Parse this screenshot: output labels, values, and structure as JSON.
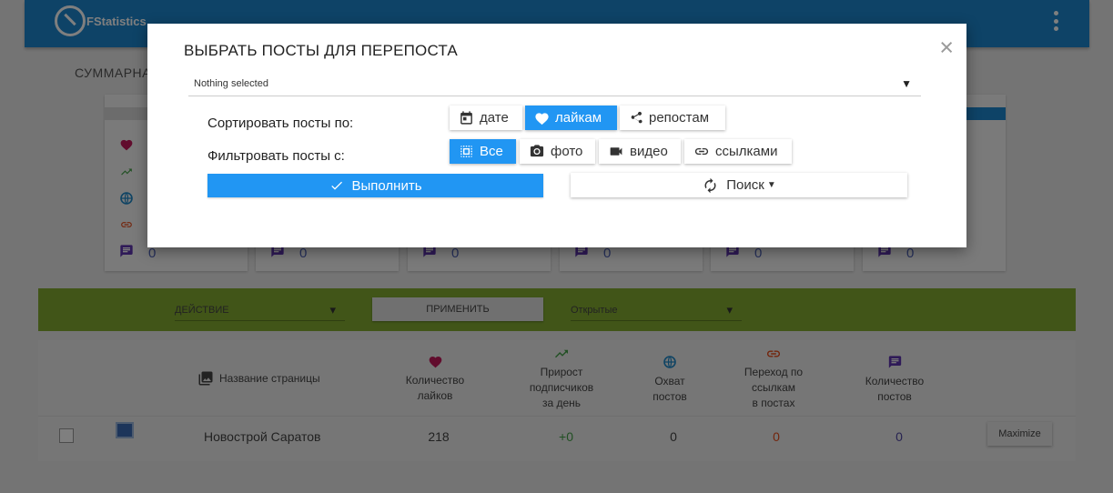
{
  "app": {
    "logo_text": "FStatistics"
  },
  "summary": {
    "title": "СУММАРНА"
  },
  "cards": [
    {
      "posts": "0"
    },
    {
      "posts": "0"
    },
    {
      "posts": "0"
    },
    {
      "posts": "0"
    },
    {
      "posts": "0"
    },
    {
      "posts": "0"
    }
  ],
  "action_bar": {
    "action_dropdown": "ДЕЙСТВИЕ",
    "apply_button": "ПРИМЕНИТЬ",
    "visibility_dropdown": "Открытые"
  },
  "table": {
    "headers": {
      "page_name": "Название страницы",
      "likes": [
        "Количество",
        "лайков"
      ],
      "growth": [
        "Прирост",
        "подписчиков",
        "за день"
      ],
      "reach": [
        "Охват",
        "постов"
      ],
      "link_clicks": [
        "Переход по",
        "ссылкам",
        "в постах"
      ],
      "posts": [
        "Количество",
        "постов"
      ]
    },
    "rows": [
      {
        "page_name": "Новострой Саратов",
        "likes": "218",
        "growth": "+0",
        "reach": "0",
        "link_clicks": "0",
        "posts": "0",
        "action": "Maximize"
      }
    ]
  },
  "colors": {
    "primary": "#2196f3",
    "header_blue": "#1d87cf",
    "action_green": "#82ab31",
    "like": "#c2185b",
    "growth": "#43a047",
    "reach": "#1e88c8",
    "link": "#e64a19",
    "posts": "#5e35b1"
  },
  "modal": {
    "title": "ВЫБРАТЬ ПОСТЫ ДЛЯ ПЕРЕПОСТА",
    "select_placeholder": "Nothing selected",
    "sort_label": "Сортировать посты по:",
    "sort_options": [
      {
        "label": "дате",
        "icon": "calendar-icon",
        "active": false
      },
      {
        "label": "лайкам",
        "icon": "heart-icon",
        "active": true
      },
      {
        "label": "репостам",
        "icon": "share-icon",
        "active": false
      }
    ],
    "filter_label": "Фильтровать посты с:",
    "filter_options": [
      {
        "label": "Все",
        "icon": "select-all-icon",
        "active": true
      },
      {
        "label": "фото",
        "icon": "camera-icon",
        "active": false
      },
      {
        "label": "видео",
        "icon": "videocam-icon",
        "active": false
      },
      {
        "label": "ссылками",
        "icon": "link-icon",
        "active": false
      }
    ],
    "execute_button": "Выполнить",
    "search_button": "Поиск",
    "close_symbol": "×"
  }
}
